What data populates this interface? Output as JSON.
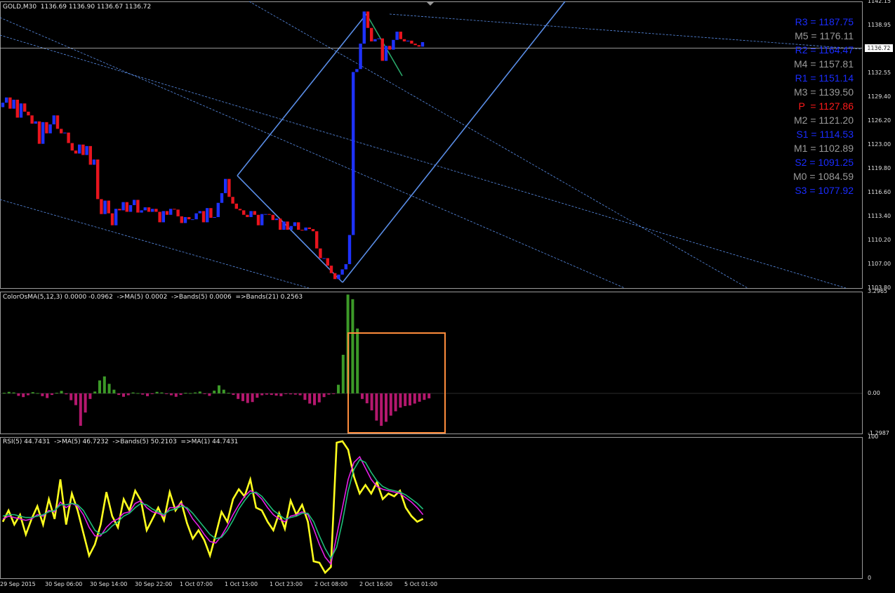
{
  "header": {
    "symbol_line": "GOLD,M30  1136.69 1136.90 1136.67 1136.72",
    "osma_line": "ColorOsMA(5,12,3) 0.0000 -0.0962  ->MA(5) 0.0002  ->Bands(5) 0.0006  =>Bands(21) 0.2563",
    "rsi_line": "RSI(5) 44.7431  ->MA(5) 46.7232  ->Bands(5) 50.2103  =>MA(1) 44.7431"
  },
  "current_price_label": "1136.72",
  "pivot_levels": [
    {
      "text": "R3 = 1187.75",
      "color": "#1a2cff"
    },
    {
      "text": "M5 = 1176.11",
      "color": "#9a9a9a"
    },
    {
      "text": "R2 = 1164.47",
      "color": "#1a2cff"
    },
    {
      "text": "M4 = 1157.81",
      "color": "#9a9a9a"
    },
    {
      "text": "R1 = 1151.14",
      "color": "#1a2cff"
    },
    {
      "text": "M3 = 1139.50",
      "color": "#9a9a9a"
    },
    {
      "text": "P  = 1127.86",
      "color": "#ff1a1a"
    },
    {
      "text": "M2 = 1121.20",
      "color": "#9a9a9a"
    },
    {
      "text": "S1 = 1114.53",
      "color": "#1a2cff"
    },
    {
      "text": "M1 = 1102.89",
      "color": "#9a9a9a"
    },
    {
      "text": "S2 = 1091.25",
      "color": "#1a2cff"
    },
    {
      "text": "M0 = 1084.59",
      "color": "#9a9a9a"
    },
    {
      "text": "S3 = 1077.92",
      "color": "#1a2cff"
    }
  ],
  "colors": {
    "bull": "#1e32ff",
    "bear": "#e8141e",
    "trend": "#5a8ee8",
    "osma_pos": "#3c9a28",
    "osma_neg": "#b4186e",
    "highlight": "#ff8c3c"
  },
  "chart_data": [
    {
      "type": "candlestick",
      "title": "GOLD,M30",
      "y_ticks": [
        "1142.15",
        "1138.95",
        "1135.75",
        "1132.55",
        "1129.40",
        "1126.20",
        "1123.00",
        "1119.80",
        "1116.60",
        "1113.40",
        "1110.20",
        "1107.00",
        "1103.80"
      ],
      "ylim": [
        1103.8,
        1142.15
      ],
      "x_ticks": [
        "29 Sep 2015",
        "30 Sep 06:00",
        "30 Sep 14:00",
        "30 Sep 22:00",
        "1 Oct 07:00",
        "1 Oct 15:00",
        "1 Oct 23:00",
        "2 Oct 08:00",
        "2 Oct 16:00",
        "5 Oct 01:00"
      ],
      "close": [
        1128.6,
        1129.3,
        1127.8,
        1129.0,
        1126.6,
        1128.5,
        1127.4,
        1126.9,
        1125.8,
        1126.1,
        1123.1,
        1126.0,
        1124.5,
        1125.7,
        1126.9,
        1125.1,
        1124.5,
        1124.6,
        1123.2,
        1122.2,
        1121.8,
        1123.0,
        1121.6,
        1122.8,
        1120.3,
        1121.0,
        1115.7,
        1113.7,
        1115.5,
        1113.8,
        1112.2,
        1114.4,
        1114.2,
        1115.3,
        1114.0,
        1114.9,
        1115.6,
        1113.9,
        1114.2,
        1114.6,
        1114.0,
        1114.4,
        1114.0,
        1112.6,
        1114.1,
        1113.6,
        1114.4,
        1114.3,
        1113.4,
        1112.5,
        1113.3,
        1113.0,
        1113.0,
        1113.8,
        1114.1,
        1112.6,
        1114.5,
        1113.2,
        1113.3,
        1115.2,
        1116.5,
        1118.4,
        1116.0,
        1115.1,
        1114.4,
        1114.2,
        1113.6,
        1113.3,
        1114.1,
        1113.6,
        1112.2,
        1113.7,
        1113.7,
        1113.6,
        1112.9,
        1113.1,
        1111.6,
        1112.7,
        1111.6,
        1112.1,
        1112.6,
        1111.6,
        1111.5,
        1111.9,
        1111.7,
        1111.4,
        1109.1,
        1107.8,
        1107.8,
        1106.8,
        1105.8,
        1105.0,
        1105.6,
        1106.3,
        1107.0,
        1110.9,
        1132.7,
        1133.1,
        1136.5,
        1140.8,
        1138.6,
        1136.8,
        1137.1,
        1137.2,
        1134.2,
        1136.2,
        1135.7,
        1137.0,
        1138.1,
        1137.1,
        1136.8,
        1136.9,
        1136.5,
        1136.3,
        1136.1,
        1136.7
      ]
    },
    {
      "type": "bar",
      "title": "ColorOsMA(5,12,3)",
      "y_ticks": [
        "3.2965",
        "0.00",
        "-1.2987"
      ],
      "ylim": [
        -1.2987,
        3.2965
      ],
      "values": [
        0.02,
        0.05,
        0.03,
        -0.08,
        -0.12,
        -0.06,
        0.04,
        0.01,
        -0.09,
        -0.15,
        -0.05,
        0.02,
        0.08,
        -0.03,
        -0.22,
        -0.38,
        -1.05,
        -0.62,
        -0.18,
        0.06,
        0.42,
        0.55,
        0.31,
        0.12,
        -0.05,
        -0.11,
        -0.06,
        0.03,
        0.01,
        -0.04,
        -0.09,
        -0.02,
        0.05,
        0.03,
        -0.01,
        -0.06,
        -0.11,
        -0.05,
        0.02,
        0.01,
        0.03,
        0.06,
        -0.02,
        -0.08,
        0.09,
        0.26,
        0.12,
        0.02,
        -0.05,
        -0.18,
        -0.25,
        -0.31,
        -0.28,
        -0.14,
        -0.06,
        -0.04,
        -0.05,
        -0.07,
        -0.09,
        -0.02,
        -0.03,
        -0.04,
        -0.06,
        -0.21,
        -0.33,
        -0.38,
        -0.29,
        -0.12,
        -0.04,
        -0.01,
        0.28,
        1.25,
        3.2,
        3.05,
        2.1,
        -0.18,
        -0.32,
        -0.55,
        -0.88,
        -1.05,
        -0.92,
        -0.72,
        -0.58,
        -0.46,
        -0.41,
        -0.39,
        -0.33,
        -0.27,
        -0.21,
        -0.16
      ]
    },
    {
      "type": "line",
      "title": "RSI(5)",
      "y_ticks": [
        "100",
        "0"
      ],
      "ylim": [
        0,
        100
      ],
      "series": [
        {
          "name": "RSI(5)",
          "color": "#ffff1e",
          "values": [
            40,
            48,
            38,
            45,
            31,
            42,
            51,
            38,
            56,
            42,
            70,
            38,
            60,
            48,
            32,
            16,
            24,
            38,
            61,
            44,
            36,
            56,
            48,
            62,
            55,
            34,
            42,
            50,
            41,
            61,
            48,
            54,
            39,
            28,
            34,
            27,
            16,
            31,
            47,
            40,
            56,
            63,
            58,
            70,
            50,
            48,
            40,
            34,
            46,
            35,
            55,
            45,
            52,
            40,
            12,
            11,
            4,
            8,
            96,
            97,
            91,
            72,
            60,
            66,
            60,
            68,
            56,
            60,
            58,
            62,
            50,
            44,
            40,
            42
          ]
        },
        {
          "name": "->MA(5)",
          "color": "#e61ee6",
          "values": [
            42,
            44,
            43,
            42,
            41,
            42,
            45,
            44,
            48,
            47,
            54,
            50,
            53,
            51,
            45,
            36,
            30,
            30,
            36,
            40,
            42,
            46,
            47,
            53,
            55,
            50,
            47,
            46,
            44,
            50,
            50,
            53,
            49,
            42,
            37,
            31,
            26,
            25,
            30,
            37,
            45,
            52,
            58,
            62,
            60,
            56,
            50,
            45,
            42,
            40,
            44,
            45,
            47,
            45,
            35,
            24,
            15,
            10,
            30,
            50,
            70,
            82,
            86,
            78,
            70,
            65,
            63,
            62,
            61,
            60,
            57,
            54,
            50,
            45
          ]
        },
        {
          "name": "->Bands(5)",
          "color": "#1ebe78",
          "values": [
            44,
            45,
            45,
            44,
            43,
            43,
            44,
            45,
            47,
            48,
            52,
            52,
            53,
            52,
            48,
            41,
            34,
            31,
            33,
            37,
            40,
            44,
            46,
            50,
            53,
            52,
            49,
            47,
            45,
            48,
            49,
            51,
            50,
            46,
            41,
            36,
            31,
            28,
            29,
            34,
            41,
            49,
            55,
            60,
            61,
            58,
            53,
            48,
            45,
            42,
            43,
            44,
            46,
            46,
            40,
            30,
            21,
            14,
            22,
            40,
            62,
            77,
            84,
            82,
            75,
            69,
            65,
            63,
            62,
            61,
            59,
            56,
            53,
            49
          ]
        }
      ]
    }
  ]
}
